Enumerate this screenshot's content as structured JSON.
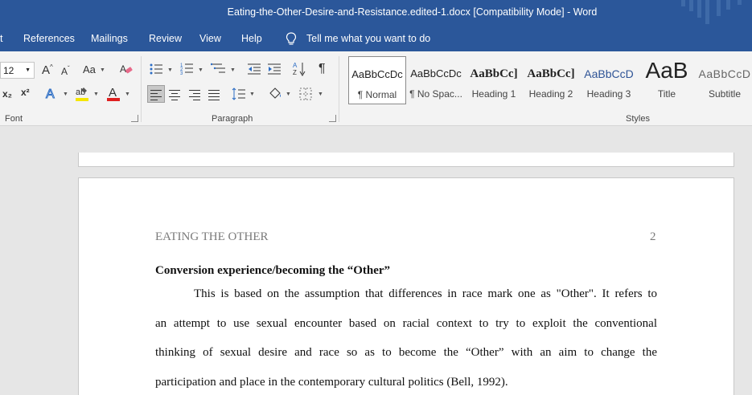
{
  "window": {
    "title": "Eating-the-Other-Desire-and-Resistance.edited-1.docx [Compatibility Mode]  -  Word"
  },
  "menu": {
    "items": [
      "References",
      "Mailings",
      "Review",
      "View",
      "Help"
    ],
    "tell_me": "Tell me what you want to do"
  },
  "ribbon": {
    "font": {
      "size": "12",
      "case_label": "Aa",
      "grow_label": "A",
      "shrink_label": "A",
      "subscript": "x₂",
      "superscript": "x²",
      "group_label": "Font"
    },
    "paragraph": {
      "group_label": "Paragraph"
    },
    "styles": {
      "group_label": "Styles",
      "items": [
        {
          "sample": "AaBbCcDc",
          "name": "¶ Normal"
        },
        {
          "sample": "AaBbCcDc",
          "name": "¶ No Spac..."
        },
        {
          "sample": "AaBbCc]",
          "name": "Heading 1"
        },
        {
          "sample": "AaBbCc]",
          "name": "Heading 2"
        },
        {
          "sample": "AaBbCcD",
          "name": "Heading 3"
        },
        {
          "sample": "AaB",
          "name": "Title"
        },
        {
          "sample": "AaBbCcD",
          "name": "Subtitle"
        }
      ]
    },
    "colors": {
      "highlight": "#f5e600",
      "font_color": "#e02020"
    }
  },
  "document": {
    "header_left": "EATING THE OTHER",
    "page_number": "2",
    "heading": "Conversion experience/becoming the “Other”",
    "lines": [
      "This is based on the assumption that differences in race mark one as \"Other\". It refers to",
      "an attempt to use sexual encounter based on racial context to try to exploit the conventional",
      "thinking of sexual desire and race so as to become the “Other” with an aim to change the",
      "participation and place in the contemporary cultural politics (Bell, 1992)."
    ]
  },
  "theme": {
    "brand": "#2b579a"
  }
}
